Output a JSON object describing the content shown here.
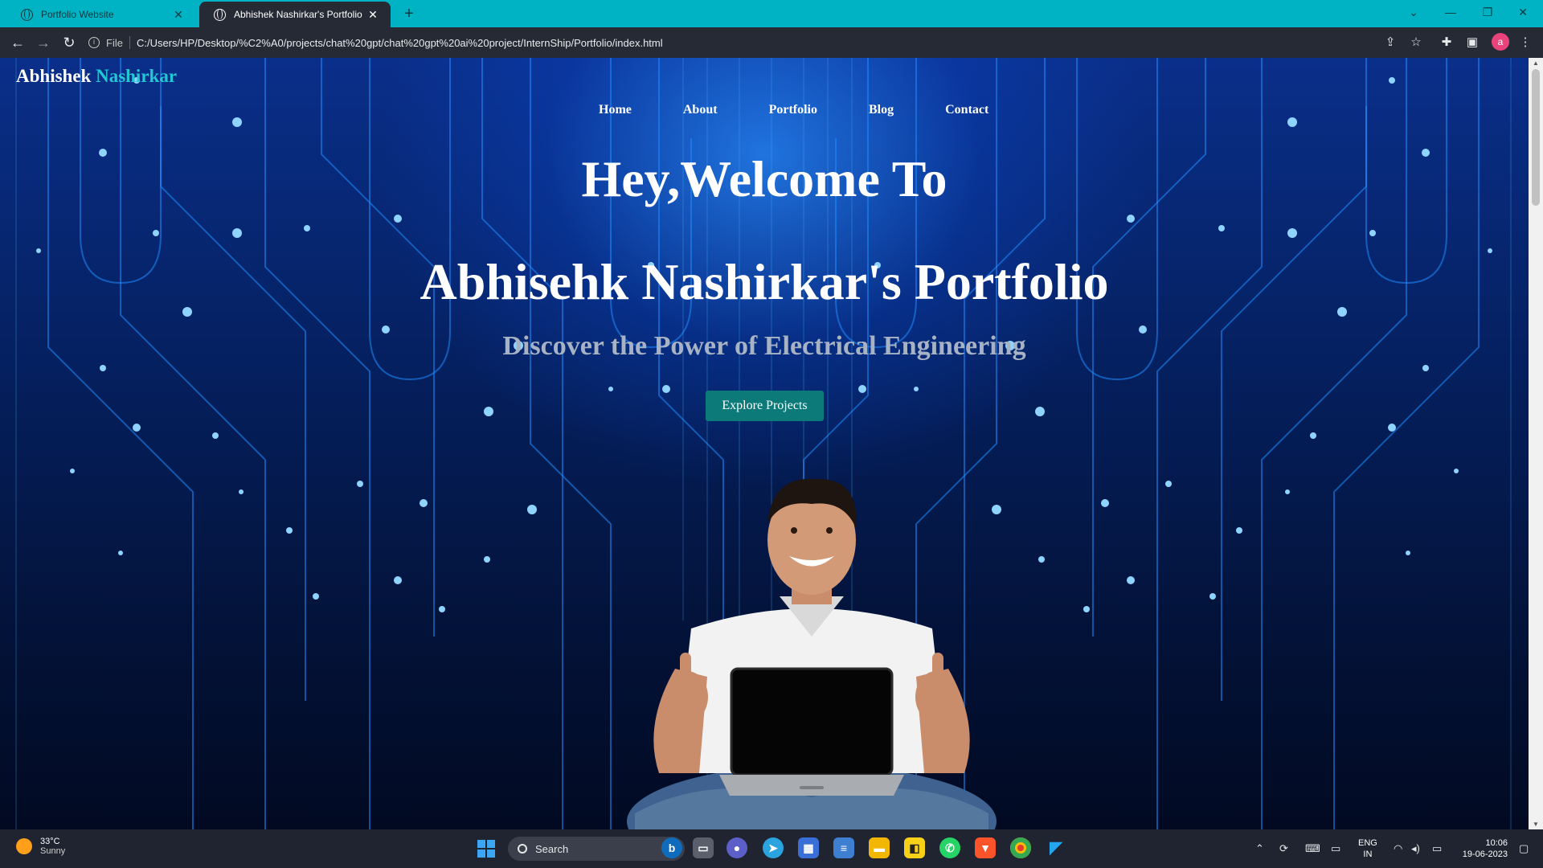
{
  "browser": {
    "tabs": [
      {
        "title": "Portfolio Website",
        "active": false
      },
      {
        "title": "Abhishek Nashirkar's Portfolio",
        "active": true
      }
    ],
    "new_tab_glyph": "+",
    "window_controls": {
      "dropdown": "⌄",
      "minimize": "—",
      "restore": "❐",
      "close": "✕"
    },
    "address": {
      "scheme_label": "File",
      "url": "C:/Users/HP/Desktop/%C2%A0/projects/chat%20gpt/chat%20gpt%20ai%20project/InternShip/Portfolio/index.html"
    },
    "profile_initial": "a",
    "nav_icons": [
      "back-arrow-icon",
      "forward-arrow-icon",
      "reload-icon"
    ],
    "toolbar_icons": [
      "share-icon",
      "bookmark-star-icon",
      "extensions-puzzle-icon",
      "side-panel-icon",
      "kebab-menu-icon"
    ]
  },
  "page": {
    "brand": {
      "first": "Abhishek",
      "last": "Nashirkar"
    },
    "nav": [
      "Home",
      "About",
      "Portfolio",
      "Blog",
      "Contact"
    ],
    "hero": {
      "line1": "Hey,Welcome To",
      "line2": "Abhisehk Nashirkar's Portfolio",
      "tagline": "Discover the Power of Electrical Engineering",
      "cta": "Explore Projects"
    },
    "colors": {
      "accent": "#22c7d4",
      "cta_bg": "#0b7a78",
      "tab_strip": "#00b3c4"
    }
  },
  "taskbar": {
    "weather": {
      "temp": "33°C",
      "desc": "Sunny"
    },
    "search_label": "Search",
    "pinned_apps": [
      "bing-icon",
      "task-view-icon",
      "teams-icon",
      "telegram-icon",
      "store-icon",
      "notepad-icon",
      "file-explorer-icon",
      "sticky-notes-icon",
      "whatsapp-icon",
      "brave-icon",
      "chrome-icon",
      "vscode-icon"
    ],
    "language": {
      "line1": "ENG",
      "line2": "IN"
    },
    "clock": {
      "time": "10:06",
      "date": "19-06-2023"
    }
  }
}
